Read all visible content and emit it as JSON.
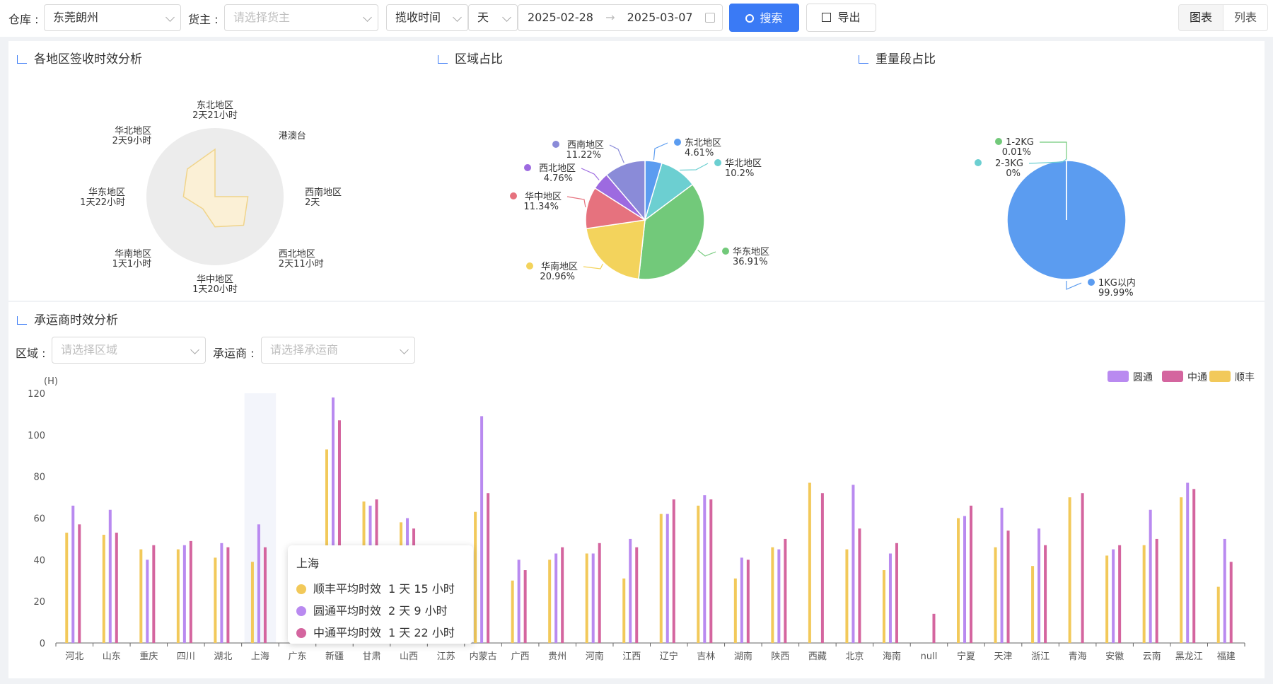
{
  "filters": {
    "warehouse_label": "仓库 :",
    "warehouse_value": "东莞朗州",
    "owner_label": "货主 :",
    "owner_placeholder": "请选择货主",
    "time_type": "揽收时间",
    "unit": "天",
    "date_start": "2025-02-28",
    "date_arrow": "→",
    "date_end": "2025-03-07",
    "search_label": "搜索",
    "export_label": "导出",
    "view_chart": "图表",
    "view_list": "列表"
  },
  "panels": {
    "region_radar_title": "各地区签收时效分析",
    "region_share_title": "区域占比",
    "weight_share_title": "重量段占比",
    "carrier_title": "承运商时效分析"
  },
  "carrier_filters": {
    "area_label": "区域 :",
    "area_placeholder": "请选择区域",
    "carrier_label": "承运商 :",
    "carrier_placeholder": "请选择承运商"
  },
  "colors": {
    "primary": "#3a7af5",
    "sf": "#f2c95a",
    "yt": "#b98af0",
    "zt": "#d4659f"
  },
  "tooltip": {
    "title": "上海",
    "rows": [
      {
        "label": "顺丰平均时效",
        "value": "1 天 15 小时",
        "color": "#f2c95a"
      },
      {
        "label": "圆通平均时效",
        "value": "2 天 9 小时",
        "color": "#b98af0"
      },
      {
        "label": "中通平均时效",
        "value": "1 天 22 小时",
        "color": "#d4659f"
      }
    ]
  },
  "chart_data": [
    {
      "type": "radar",
      "title": "各地区签收时效分析",
      "indicators": [
        {
          "name": "东北地区",
          "value_label": "2天21小时",
          "hours": 69
        },
        {
          "name": "港澳台",
          "value_label": "",
          "hours": 0
        },
        {
          "name": "西南地区",
          "value_label": "2天",
          "hours": 48
        },
        {
          "name": "西北地区",
          "value_label": "2天11小时",
          "hours": 59
        },
        {
          "name": "华中地区",
          "value_label": "1天20小时",
          "hours": 44
        },
        {
          "name": "华南地区",
          "value_label": "1天1小时",
          "hours": 25
        },
        {
          "name": "华东地区",
          "value_label": "1天22小时",
          "hours": 46
        },
        {
          "name": "华北地区",
          "value_label": "2天9小时",
          "hours": 57
        }
      ],
      "max": 100
    },
    {
      "type": "pie",
      "title": "区域占比",
      "slices": [
        {
          "name": "东北地区",
          "value": 4.61,
          "label": "4.61%",
          "color": "#5b9cf0"
        },
        {
          "name": "华北地区",
          "value": 10.2,
          "label": "10.2%",
          "color": "#6ccfd1"
        },
        {
          "name": "华东地区",
          "value": 36.91,
          "label": "36.91%",
          "color": "#72c97a"
        },
        {
          "name": "华南地区",
          "value": 20.96,
          "label": "20.96%",
          "color": "#f3d35c"
        },
        {
          "name": "华中地区",
          "value": 11.34,
          "label": "11.34%",
          "color": "#e6727e"
        },
        {
          "name": "西北地区",
          "value": 4.76,
          "label": "4.76%",
          "color": "#9d6ae0"
        },
        {
          "name": "西南地区",
          "value": 11.22,
          "label": "11.22%",
          "color": "#8a8bd8"
        }
      ]
    },
    {
      "type": "pie",
      "title": "重量段占比",
      "slices": [
        {
          "name": "1KG以内",
          "value": 99.99,
          "label": "99.99%",
          "color": "#5b9cf0"
        },
        {
          "name": "1-2KG",
          "value": 0.01,
          "label": "0.01%",
          "color": "#72c97a"
        },
        {
          "name": "2-3KG",
          "value": 0,
          "label": "0%",
          "color": "#6ccfd1"
        }
      ]
    },
    {
      "type": "bar",
      "title": "承运商时效分析",
      "ylabel": "(H)",
      "ylim": [
        0,
        120
      ],
      "yticks": [
        0,
        20,
        40,
        60,
        80,
        100,
        120
      ],
      "categories": [
        "河北",
        "山东",
        "重庆",
        "四川",
        "湖北",
        "上海",
        "广东",
        "新疆",
        "甘肃",
        "山西",
        "江苏",
        "内蒙古",
        "广西",
        "贵州",
        "河南",
        "江西",
        "辽宁",
        "吉林",
        "湖南",
        "陕西",
        "西藏",
        "北京",
        "海南",
        "null",
        "宁夏",
        "天津",
        "浙江",
        "青海",
        "安徽",
        "云南",
        "黑龙江",
        "福建"
      ],
      "highlight_category": "上海",
      "legend": [
        "圆通",
        "中通",
        "顺丰"
      ],
      "series": [
        {
          "name": "顺丰",
          "color": "#f2c95a",
          "values": [
            53,
            52,
            45,
            45,
            41,
            39,
            0,
            93,
            68,
            58,
            0,
            63,
            30,
            40,
            43,
            31,
            62,
            66,
            31,
            46,
            77,
            45,
            35,
            0,
            60,
            46,
            37,
            70,
            42,
            47,
            70,
            27
          ]
        },
        {
          "name": "圆通",
          "color": "#b98af0",
          "values": [
            66,
            64,
            40,
            47,
            48,
            57,
            0,
            118,
            66,
            60,
            0,
            109,
            40,
            43,
            43,
            50,
            62,
            71,
            41,
            45,
            0,
            76,
            43,
            0,
            61,
            65,
            55,
            0,
            45,
            64,
            77,
            50
          ]
        },
        {
          "name": "中通",
          "color": "#d4659f",
          "values": [
            57,
            53,
            47,
            49,
            46,
            46,
            0,
            107,
            69,
            55,
            0,
            72,
            35,
            46,
            48,
            46,
            69,
            69,
            40,
            50,
            72,
            55,
            48,
            14,
            66,
            54,
            47,
            72,
            47,
            50,
            74,
            39
          ]
        }
      ]
    }
  ]
}
